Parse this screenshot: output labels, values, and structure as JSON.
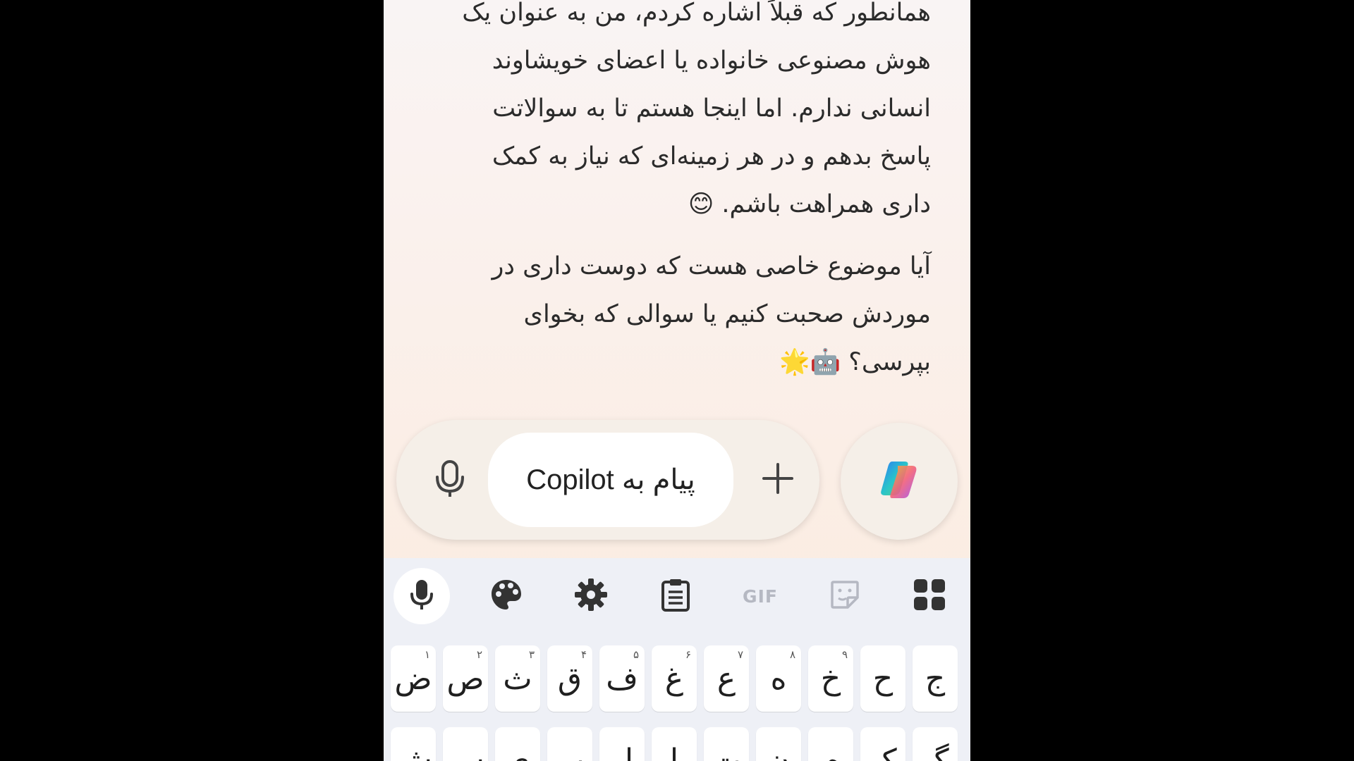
{
  "chat": {
    "paragraph1": [
      "همانطور که قبلاً اشاره کردم، من به عنوان یک",
      "هوش مصنوعی خانواده یا اعضای خویشاوند",
      "انسانی ندارم. اما اینجا هستم تا به سوالاتت",
      "پاسخ بدهم و در هر زمینه‌ای که نیاز به کمک",
      "داری همراهت باشم. 😊"
    ],
    "paragraph2": [
      "آیا موضوع خاصی هست که دوست داری در",
      "موردش صحبت کنیم یا سوالی که بخوای",
      "بپرسی؟ 🤖🌟"
    ]
  },
  "composer": {
    "placeholder": "پیام به Copilot",
    "mic_icon": "microphone-outline-icon",
    "plus_icon": "plus-icon",
    "copilot_icon": "copilot-logo-icon"
  },
  "keyboard": {
    "toolbar": {
      "items": [
        "microphone-icon",
        "palette-icon",
        "gear-icon",
        "clipboard-icon",
        "GIF",
        "sticker-icon",
        "apps-grid-icon"
      ],
      "gif_label": "GIF"
    },
    "row1": [
      {
        "char": "ض",
        "hint": "۱"
      },
      {
        "char": "ص",
        "hint": "۲"
      },
      {
        "char": "ث",
        "hint": "۳"
      },
      {
        "char": "ق",
        "hint": "۴"
      },
      {
        "char": "ف",
        "hint": "۵"
      },
      {
        "char": "غ",
        "hint": "۶"
      },
      {
        "char": "ع",
        "hint": "۷"
      },
      {
        "char": "ه",
        "hint": "۸"
      },
      {
        "char": "خ",
        "hint": "۹"
      },
      {
        "char": "ح",
        "hint": ""
      },
      {
        "char": "ج",
        "hint": ""
      }
    ],
    "row2": [
      "ش",
      "س",
      "ی",
      "ب",
      "ل",
      "ا",
      "ت",
      "ن",
      "م",
      "ک",
      "گ"
    ]
  },
  "colors": {
    "background": "#000000",
    "keyboard_bg": "#eef0f6",
    "composer_bg": "#f5efe8"
  }
}
